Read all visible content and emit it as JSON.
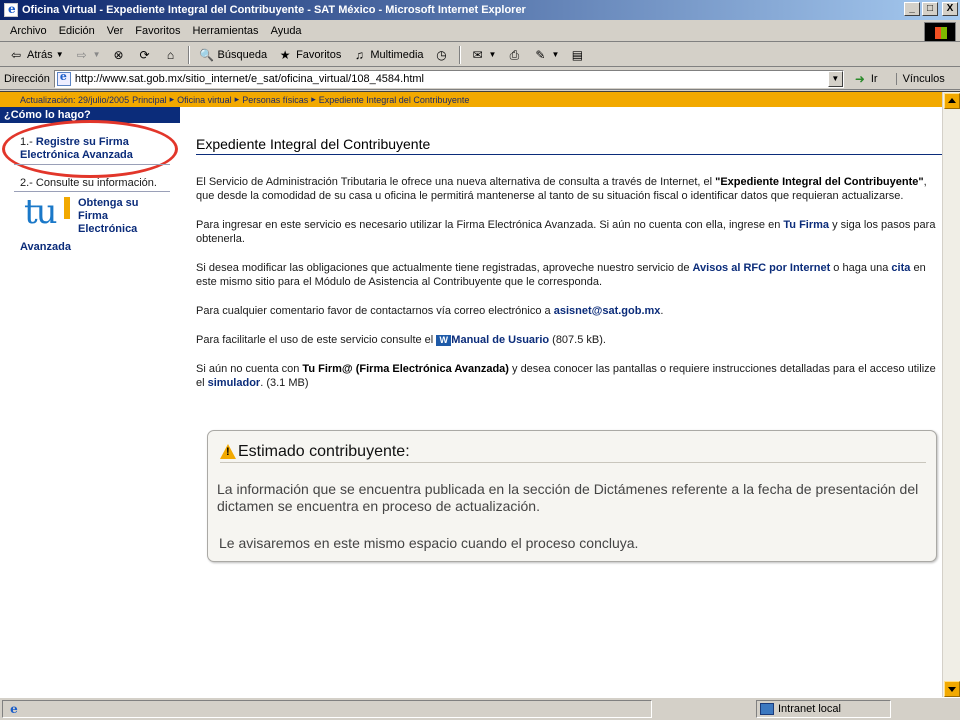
{
  "window": {
    "title": "Oficina Virtual - Expediente Integral del Contribuyente - SAT México - Microsoft Internet Explorer",
    "min_label": "_",
    "max_label": "□",
    "close_label": "X"
  },
  "menu": [
    "Archivo",
    "Edición",
    "Ver",
    "Favoritos",
    "Herramientas",
    "Ayuda"
  ],
  "toolbar": {
    "back": "Atrás",
    "search": "Búsqueda",
    "favorites": "Favoritos",
    "media": "Multimedia"
  },
  "address": {
    "label": "Dirección",
    "url": "http://www.sat.gob.mx/sitio_internet/e_sat/oficina_virtual/108_4584.html",
    "go": "Ir",
    "links": "Vínculos"
  },
  "breadcrumb": {
    "date": "Actualización: 29/julio/2005",
    "items": [
      "Principal",
      "Oficina virtual",
      "Personas físicas",
      "Expediente Integral del Contribuyente"
    ]
  },
  "sidebar": {
    "heading": "¿Cómo lo hago?",
    "step1_num": "1.- ",
    "step1_text": "Registre su Firma Electrónica Avanzada",
    "step2": "2.- Consulte su información.",
    "tu_logo": "tu",
    "tu_link_l1": "Obtenga su",
    "tu_link_l2": "Firma",
    "tu_link_l3": "Electrónica",
    "tu_link_l4": "Avanzada"
  },
  "main": {
    "title": "Expediente Integral del Contribuyente",
    "p1_a": "El Servicio de Administración Tributaria le ofrece una nueva alternativa de consulta a través de Internet, el ",
    "p1_b": "\"Expediente Integral del Contribuyente\"",
    "p1_c": ", que desde la comodidad de su casa u oficina le permitirá mantenerse al tanto de su situación fiscal o identificar datos que requieran actualizarse.",
    "p2_a": "Para ingresar en este servicio es necesario utilizar la Firma Electrónica Avanzada. Si aún no cuenta con ella, ingrese en ",
    "p2_link": "Tu Firma",
    "p2_b": " y siga los pasos para obtenerla.",
    "p3_a": "Si desea modificar las obligaciones que actualmente tiene registradas, aproveche nuestro servicio de ",
    "p3_link1": "Avisos al RFC por Internet",
    "p3_b": " o haga una ",
    "p3_link2": "cita",
    "p3_c": " en este mismo sitio para el Módulo de Asistencia al Contribuyente que le corresponda.",
    "p4_a": "Para cualquier comentario favor de contactarnos vía correo electrónico a ",
    "p4_link": "asisnet@sat.gob.mx",
    "p4_b": ".",
    "p5_a": "Para facilitarle el uso de este servicio consulte el ",
    "p5_icon": "W",
    "p5_link": "Manual de Usuario",
    "p5_b": " (807.5 kB).",
    "p6_a": "Si aún no cuenta con ",
    "p6_bold": "Tu Firm@ (Firma Electrónica Avanzada)",
    "p6_b": " y desea conocer las pantallas o requiere instrucciones detalladas para el acceso utilize el ",
    "p6_link": "simulador",
    "p6_c": ". (3.1 MB)"
  },
  "notice": {
    "title": "Estimado contribuyente:",
    "p1": "La información que se encuentra publicada en la sección de Dictámenes referente a la fecha de presentación del dictamen se encuentra en proceso de actualización.",
    "p2": "Le avisaremos en este mismo espacio cuando el proceso concluya."
  },
  "status": {
    "zone": "Intranet local"
  }
}
